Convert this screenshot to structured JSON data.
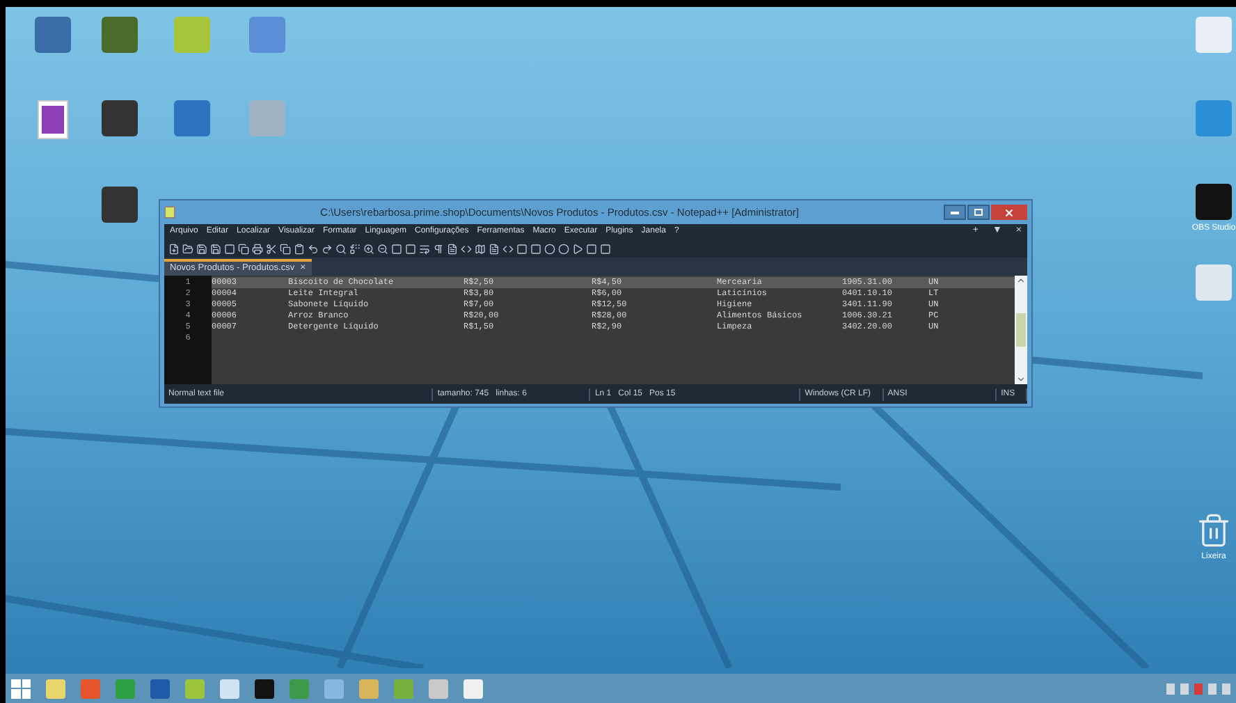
{
  "desktop_icons": [
    {
      "kind": "app"
    },
    {
      "kind": "app"
    },
    {
      "kind": "app"
    },
    {
      "kind": "app"
    },
    {
      "kind": "doc"
    },
    {
      "kind": "app"
    },
    {
      "kind": "app"
    },
    {
      "kind": "app"
    },
    {
      "kind": "app"
    },
    {
      "kind": "app"
    },
    {
      "kind": "app"
    },
    {
      "kind": "app",
      "label": "OBS Studio"
    },
    {
      "kind": "app"
    },
    {
      "kind": "bin",
      "label": "Lixeira"
    }
  ],
  "window": {
    "title": "C:\\Users\\rebarbosa.prime.shop\\Documents\\Novos Produtos - Produtos.csv - Notepad++ [Administrator]",
    "menu": [
      "Arquivo",
      "Editar",
      "Localizar",
      "Visualizar",
      "Formatar",
      "Linguagem",
      "Configurações",
      "Ferramentas",
      "Macro",
      "Executar",
      "Plugins",
      "Janela",
      "?"
    ],
    "menu_right": [
      "+",
      "▼",
      "×"
    ],
    "tabs": [
      {
        "label": "Novos Produtos - Produtos.csv",
        "selected": true,
        "close": "×"
      }
    ],
    "lines": [
      {
        "number": "1",
        "selected": true,
        "fields": [
          "00003",
          "Biscoito de Chocolate",
          "R$2,50",
          "R$4,50",
          "Mercearia",
          "1905.31.00",
          "UN"
        ]
      },
      {
        "number": "2",
        "selected": false,
        "fields": [
          "00004",
          "Leite Integral",
          "R$3,80",
          "R$6,00",
          "Laticínios",
          "0401.10.10",
          "LT"
        ]
      },
      {
        "number": "3",
        "selected": false,
        "fields": [
          "00005",
          "Sabonete Líquido",
          "R$7,00",
          "R$12,50",
          "Higiene",
          "3401.11.90",
          "UN"
        ]
      },
      {
        "number": "4",
        "selected": false,
        "fields": [
          "00006",
          "Arroz Branco",
          "R$20,00",
          "R$28,00",
          "Alimentos Básicos",
          "1006.30.21",
          "PC"
        ]
      },
      {
        "number": "5",
        "selected": false,
        "fields": [
          "00007",
          "Detergente Líquido",
          "R$1,50",
          "R$2,90",
          "Limpeza",
          "3402.20.00",
          "UN"
        ]
      },
      {
        "number": "6",
        "selected": false
      }
    ],
    "status_bar": [
      "Normal text file",
      "tamanho: 745   linhas: 6",
      "Ln 1   Col 15   Pos 15",
      "Windows (CR LF)",
      "ANSI",
      "INS"
    ]
  }
}
